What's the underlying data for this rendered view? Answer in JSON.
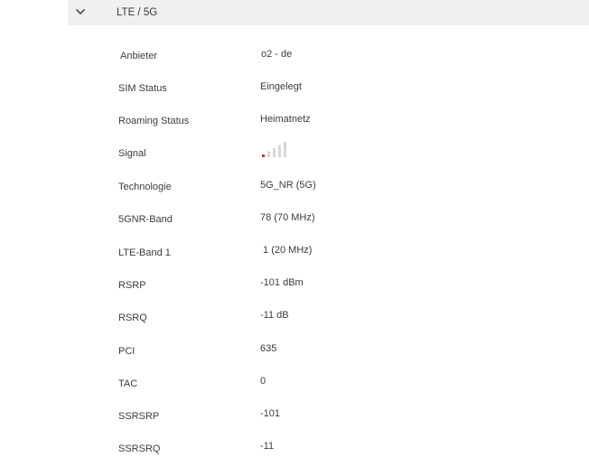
{
  "section": {
    "title": "LTE / 5G"
  },
  "rows": [
    {
      "label": "Anbieter",
      "value": "o2 - de"
    },
    {
      "label": "SIM Status",
      "value": "Eingelegt"
    },
    {
      "label": "Roaming Status",
      "value": "Heimatnetz"
    },
    {
      "label": "Signal",
      "bars_active": 1,
      "bars_total": 5
    },
    {
      "label": "Technologie",
      "value": "5G_NR (5G)"
    },
    {
      "label": "5GNR-Band",
      "value": "78 (70 MHz)"
    },
    {
      "label": "LTE-Band 1",
      "value": " 1 (20 MHz)"
    },
    {
      "label": "RSRP",
      "value": "-101 dBm"
    },
    {
      "label": "RSRQ",
      "value": "-11 dB"
    },
    {
      "label": "PCI",
      "value": "635"
    },
    {
      "label": "TAC",
      "value": "0"
    },
    {
      "label": "SSRSRP",
      "value": "-101"
    },
    {
      "label": "SSRSRQ",
      "value": "-11"
    }
  ],
  "colors": {
    "header_bg": "#f0f0f0",
    "text": "#3c3c3c",
    "signal_active": "#c0392b",
    "signal_inactive": "#d6d6d6"
  }
}
